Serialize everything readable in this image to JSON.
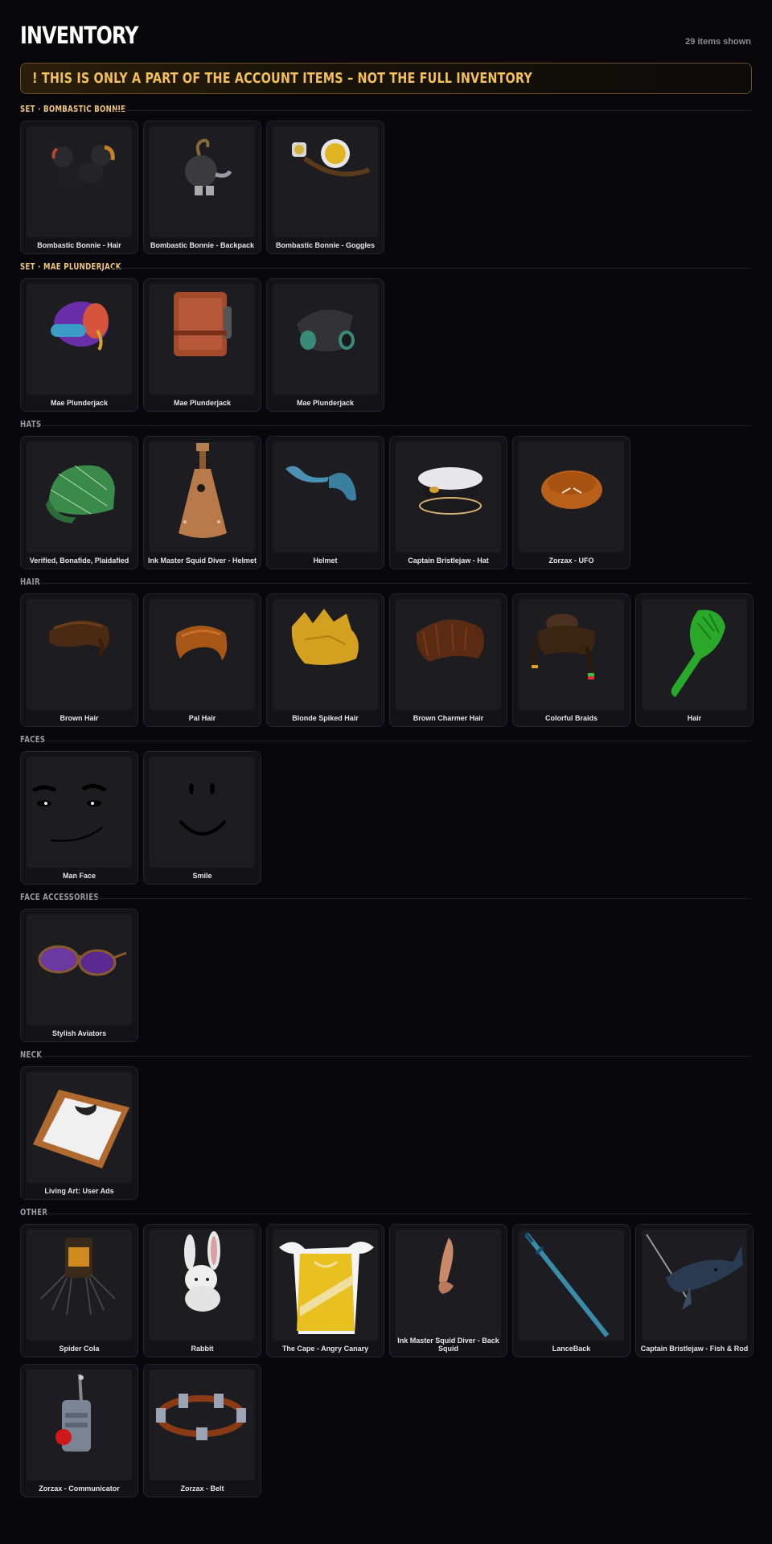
{
  "header": {
    "title": "INVENTORY",
    "count": "29 items shown"
  },
  "banner": {
    "text": "! THIS IS ONLY A PART OF THE ACCOUNT ITEMS – NOT THE FULL INVENTORY"
  },
  "sections": [
    {
      "label": "SET · BOMBASTIC BONNIE",
      "items": [
        "Bombastic Bonnie - Hair",
        "Bombastic Bonnie - Backpack",
        "Bombastic Bonnie - Goggles"
      ]
    },
    {
      "label": "SET · MAE PLUNDERJACK",
      "items": [
        "Mae Plunderjack",
        "Mae Plunderjack",
        "Mae Plunderjack"
      ]
    },
    {
      "label": "HATS",
      "items": [
        "Verified, Bonafide, Plaidafied",
        "Ink Master Squid Diver - Helmet",
        "Helmet",
        "Captain Bristlejaw - Hat",
        "Zorzax - UFO"
      ]
    },
    {
      "label": "HAIR",
      "items": [
        "Brown Hair",
        "Pal Hair",
        "Blonde Spiked Hair",
        "Brown Charmer Hair",
        "Colorful Braids",
        "Hair"
      ]
    },
    {
      "label": "FACES",
      "items": [
        "Man Face",
        "Smile"
      ]
    },
    {
      "label": "FACE ACCESSORIES",
      "items": [
        "Stylish Aviators"
      ]
    },
    {
      "label": "NECK",
      "items": [
        "Living Art: User Ads"
      ]
    },
    {
      "label": "OTHER",
      "items": [
        "Spider Cola",
        "Rabbit",
        "The Cape - Angry Canary",
        "Ink Master Squid Diver - Back Squid",
        "LanceBack",
        "Captain Bristlejaw - Fish & Rod",
        "Zorzax - Communicator",
        "Zorzax - Belt"
      ]
    }
  ],
  "colors": {
    "background": "#08080c",
    "card": "#121217",
    "thumb": "#1c1c21",
    "accent": "#f3bf59",
    "set_label": "#f0c67a"
  }
}
